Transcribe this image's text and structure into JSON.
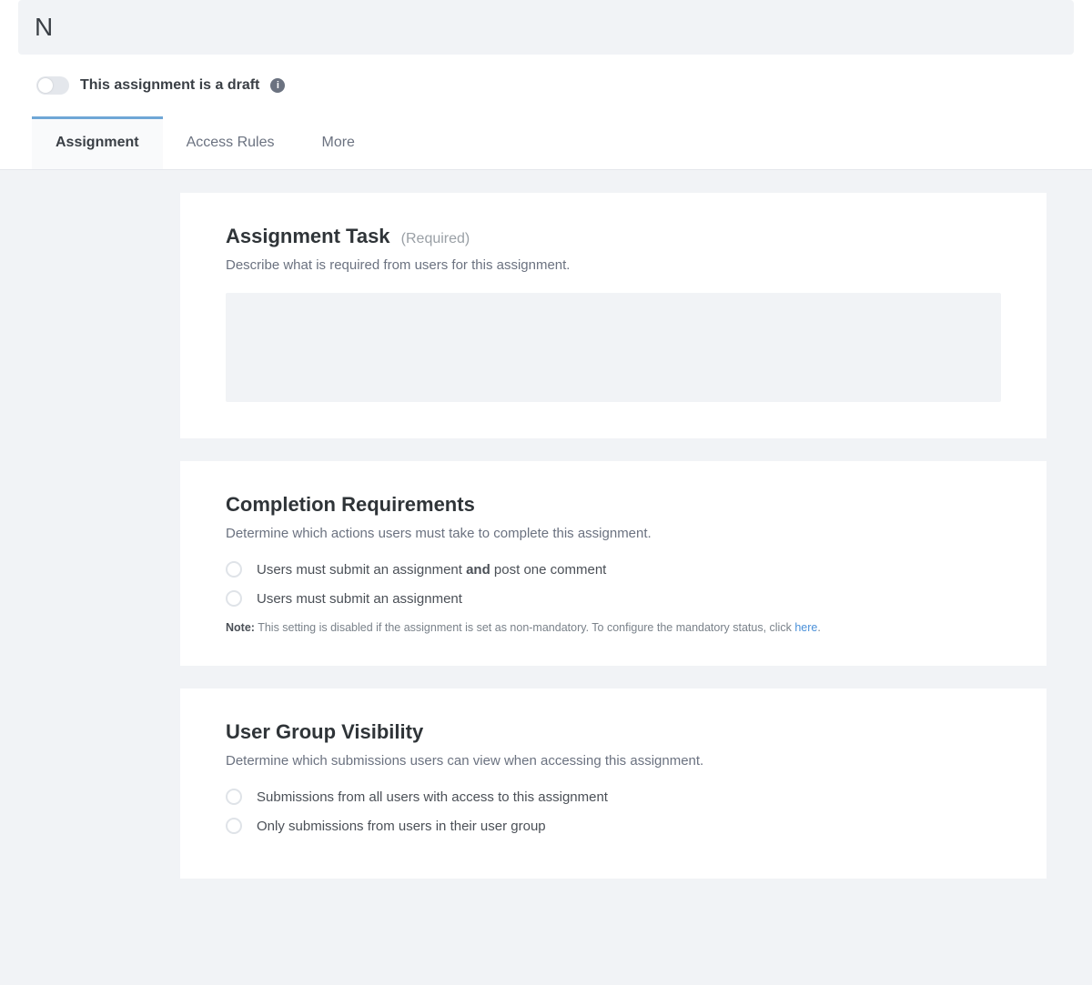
{
  "title_input": {
    "value": "N"
  },
  "draft_toggle": {
    "label": "This assignment is a draft"
  },
  "tabs": [
    {
      "id": "assignment",
      "label": "Assignment"
    },
    {
      "id": "access-rules",
      "label": "Access Rules"
    },
    {
      "id": "more",
      "label": "More"
    }
  ],
  "task_card": {
    "title": "Assignment Task",
    "required_tag": "(Required)",
    "desc": "Describe what is required from users for this assignment."
  },
  "completion_card": {
    "title": "Completion Requirements",
    "desc": "Determine which actions users must take to complete this assignment.",
    "options": [
      {
        "pre": "Users must submit an assignment ",
        "strong": "and",
        "post": " post one comment"
      },
      {
        "pre": "Users must submit an assignment",
        "strong": "",
        "post": ""
      }
    ],
    "note_label": "Note:",
    "note_text": " This setting is disabled if the assignment is set as non-mandatory. To configure the mandatory status, click ",
    "note_link": "here"
  },
  "visibility_card": {
    "title": "User Group Visibility",
    "desc": "Determine which submissions users can view when accessing this assignment.",
    "options": [
      "Submissions from all users with access to this assignment",
      "Only submissions from users in their user group"
    ]
  }
}
